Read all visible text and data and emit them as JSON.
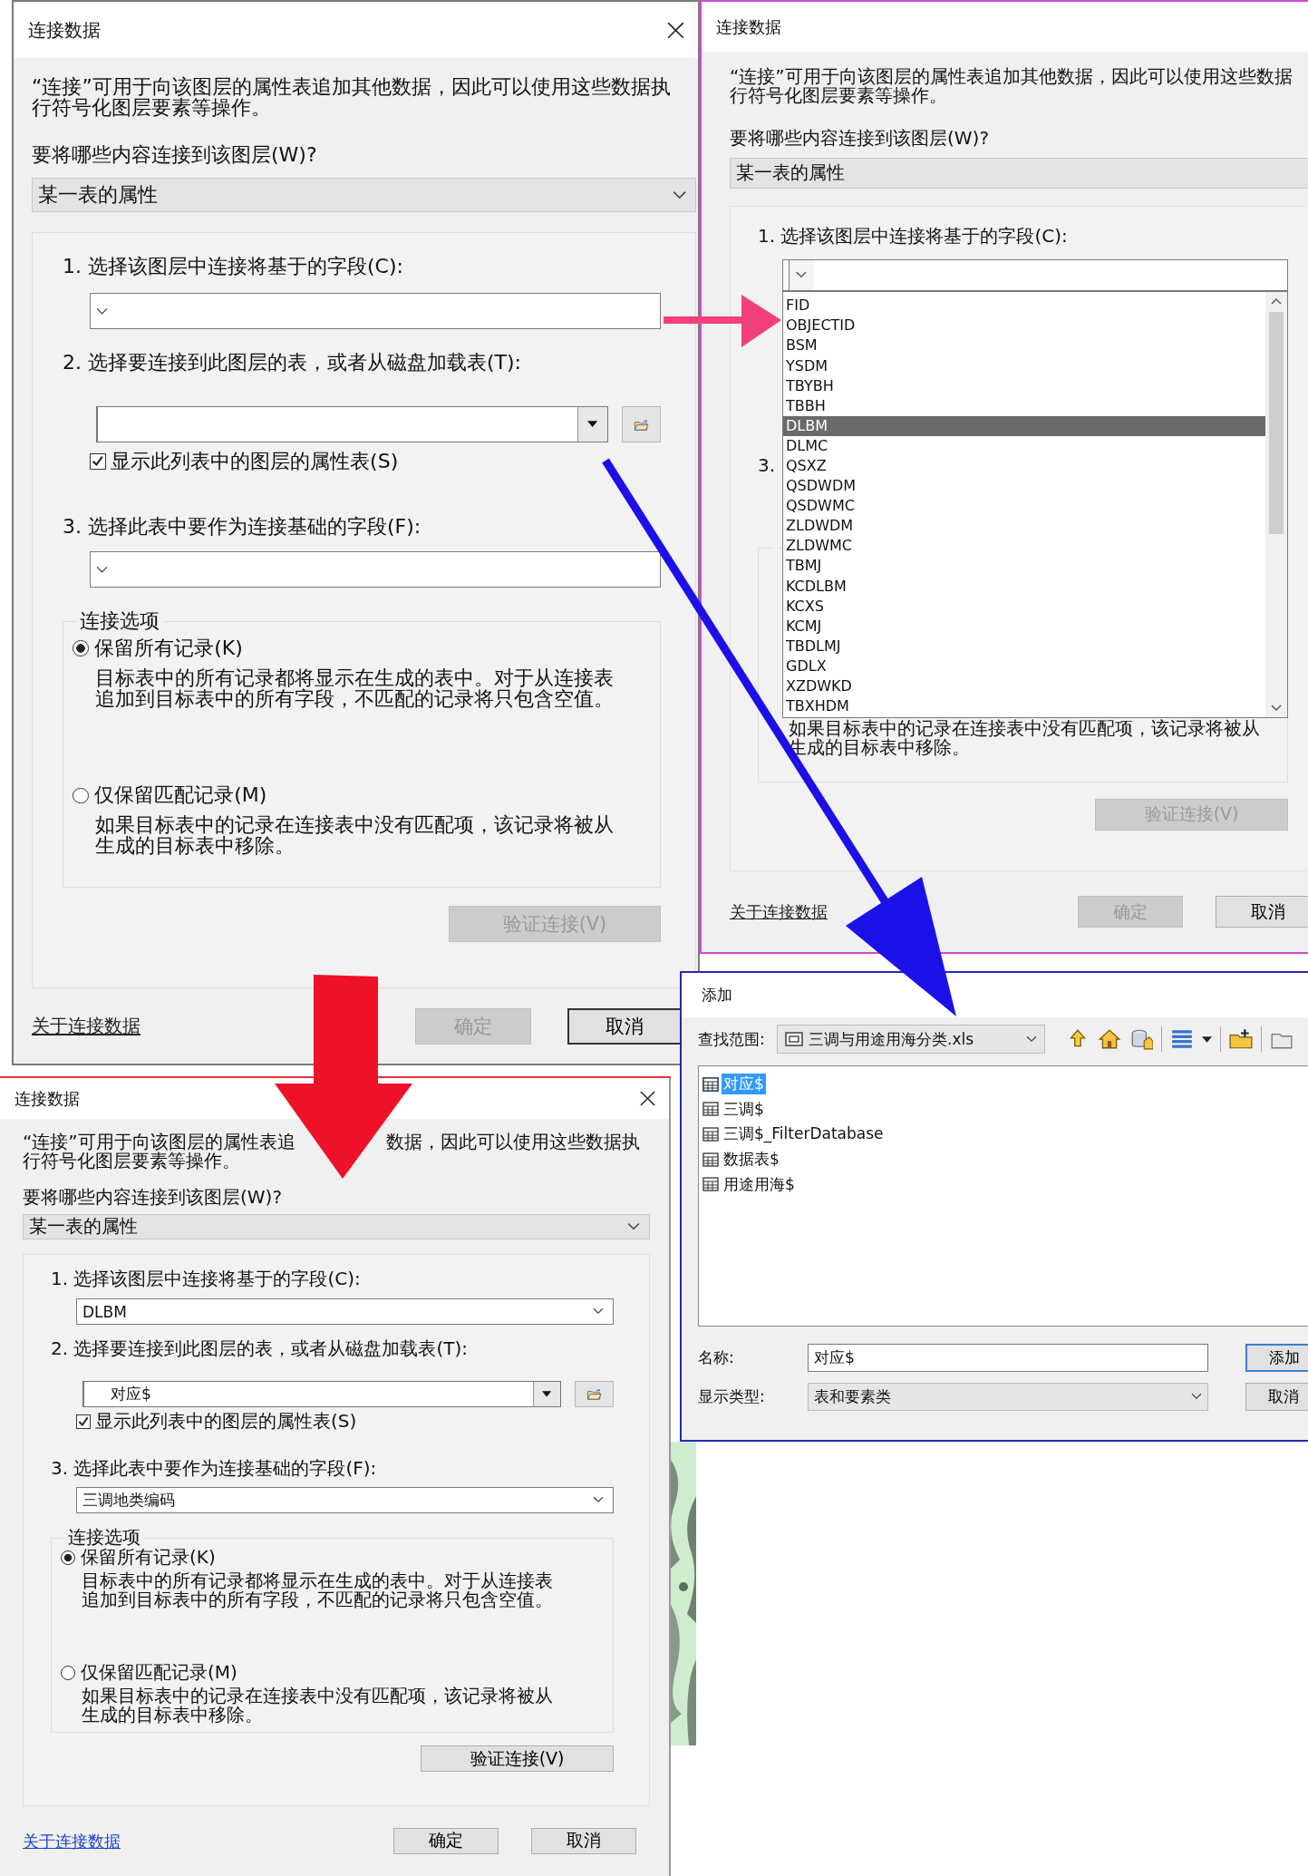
{
  "join_dialogs": [
    {
      "title": "连接数据",
      "closable": true,
      "description_lines": [
        [
          "“连接”可用于向该图层的属性表追加其他数据，因此可以使用这些数据执"
        ],
        [
          "行符号化图层要素等操作。"
        ]
      ],
      "what_label": "要将哪些内容连接到该图层(W)?",
      "what_value": "某一表的属性",
      "step1_label": "1. 选择该图层中连接将基于的字段(C):",
      "step2_label": "2. 选择要连接到此图层的表，或者从磁盘加载表(T):",
      "show_layers": {
        "label": "显示此列表中的图层的属性表(S)",
        "checked": true
      },
      "step3_label": "3. 选择此表中要作为连接基础的字段(F):",
      "options_title": "连接选项",
      "options": [
        {
          "label": "保留所有记录(K)",
          "selected": true,
          "description_lines": [
            "目标表中的所有记录都将显示在生成的表中。对于从连接表",
            "追加到目标表中的所有字段，不匹配的记录将只包含空值。"
          ]
        },
        {
          "label": "仅保留匹配记录(M)",
          "selected": false,
          "description_lines": [
            "如果目标表中的记录在连接表中没有匹配项，该记录将被从",
            "生成的目标表中移除。"
          ]
        }
      ],
      "validate_button": {
        "label": "验证连接(V)",
        "disabled": true
      },
      "about_link": "关于连接数据",
      "ok_button": {
        "label": "确定",
        "disabled": true,
        "default": false
      },
      "cancel_button": {
        "label": "取消",
        "disabled": false,
        "default": true
      }
    },
    {
      "title": "连接数据",
      "description_lines": [
        [
          "“连接”可用于向该图层的属性表追加其他数据，因此可以使用这些数据"
        ],
        [
          "行符号化图层要素等操作。"
        ]
      ],
      "what_label": "要将哪些内容连接到该图层(W)?",
      "what_value": "某一表的属性",
      "step1_label": "1. 选择该图层中连接将基于的字段(C):",
      "step1_list": [
        {
          "label": "FID",
          "selected": false
        },
        {
          "label": "OBJECTID",
          "selected": false
        },
        {
          "label": "BSM",
          "selected": false
        },
        {
          "label": "YSDM",
          "selected": false
        },
        {
          "label": "TBYBH",
          "selected": false
        },
        {
          "label": "TBBH",
          "selected": false
        },
        {
          "label": "DLBM",
          "selected": true
        },
        {
          "label": "DLMC",
          "selected": false
        },
        {
          "label": "QSXZ",
          "selected": false
        },
        {
          "label": "QSDWDM",
          "selected": false
        },
        {
          "label": "QSDWMC",
          "selected": false
        },
        {
          "label": "ZLDWDM",
          "selected": false
        },
        {
          "label": "ZLDWMC",
          "selected": false
        },
        {
          "label": "TBMJ",
          "selected": false
        },
        {
          "label": "KCDLBM",
          "selected": false
        },
        {
          "label": "KCXS",
          "selected": false
        },
        {
          "label": "KCMJ",
          "selected": false
        },
        {
          "label": "TBDLMJ",
          "selected": false
        },
        {
          "label": "GDLX",
          "selected": false
        },
        {
          "label": "XZDWKD",
          "selected": false
        },
        {
          "label": "TBXHDM",
          "selected": false
        }
      ],
      "step3_label": "3.",
      "options": [
        {
          "description_lines": [
            "如果目标表中的记录在连接表中没有匹配项，该记录将被从",
            "生成的目标表中移除。"
          ]
        }
      ],
      "validate_button": {
        "label": "验证连接(V)",
        "disabled": true
      },
      "about_link": "关于连接数据",
      "ok_button": {
        "label": "确定",
        "disabled": true,
        "default": false
      },
      "cancel_button": {
        "label": "取消",
        "disabled": false,
        "default": false
      }
    },
    {
      "title": "连接数据",
      "closable": true,
      "description_lines": [
        [
          "“连接”可用于向该图层的属性表追",
          "数据，因此可以使用这些数据执"
        ],
        [
          "行符号化图层要素等操作。"
        ]
      ],
      "what_label": "要将哪些内容连接到该图层(W)?",
      "what_value": "某一表的属性",
      "step1_label": "1. 选择该图层中连接将基于的字段(C):",
      "step1_value": "DLBM",
      "step2_label": "2. 选择要连接到此图层的表，或者从磁盘加载表(T):",
      "step2_value": "对应$",
      "show_layers": {
        "label": "显示此列表中的图层的属性表(S)",
        "checked": true
      },
      "step3_label": "3. 选择此表中要作为连接基础的字段(F):",
      "step3_value": "三调地类编码",
      "options_title": "连接选项",
      "options": [
        {
          "label": "保留所有记录(K)",
          "selected": true,
          "description_lines": [
            "目标表中的所有记录都将显示在生成的表中。对于从连接表",
            "追加到目标表中的所有字段，不匹配的记录将只包含空值。"
          ]
        },
        {
          "label": "仅保留匹配记录(M)",
          "selected": false,
          "description_lines": [
            "如果目标表中的记录在连接表中没有匹配项，该记录将被从",
            "生成的目标表中移除。"
          ]
        }
      ],
      "validate_button": {
        "label": "验证连接(V)",
        "disabled": false
      },
      "about_link": "关于连接数据",
      "ok_button": {
        "label": "确定",
        "disabled": false,
        "default": false
      },
      "cancel_button": {
        "label": "取消",
        "disabled": false,
        "default": false
      }
    }
  ],
  "add_dialog": {
    "title": "添加",
    "look_in_label": "查找范围:",
    "look_in_value": "三调与用途用海分类.xls",
    "items": [
      {
        "label": "对应$",
        "selected": true
      },
      {
        "label": "三调$",
        "selected": false
      },
      {
        "label": "三调$_FilterDatabase",
        "selected": false
      },
      {
        "label": "数据表$",
        "selected": false
      },
      {
        "label": "用途用海$",
        "selected": false
      }
    ],
    "name_label": "名称:",
    "name_value": "对应$",
    "type_label": "显示类型:",
    "type_value": "表和要素类",
    "add_button": "添加",
    "cancel_button": "取消"
  },
  "arrows": [
    {
      "color": "#f2407c"
    },
    {
      "color": "#1c10e8"
    },
    {
      "color": "#ee1128"
    }
  ]
}
